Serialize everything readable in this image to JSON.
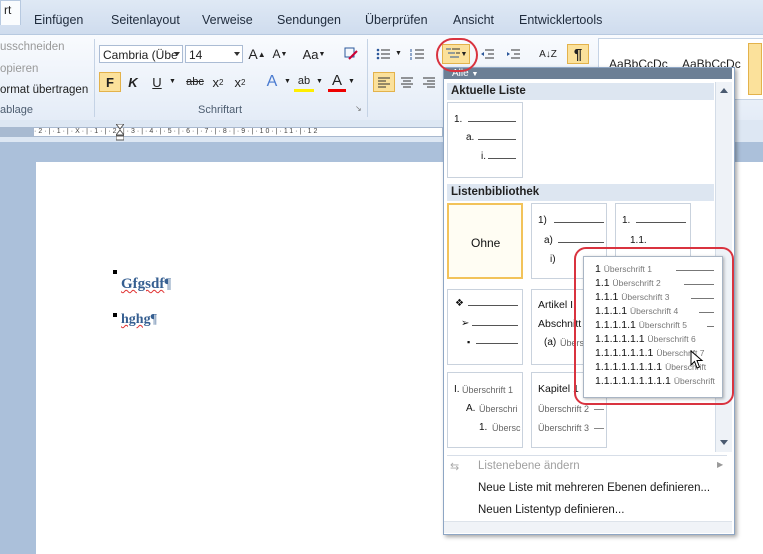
{
  "tabs": {
    "active": "rt",
    "items": [
      "Einfügen",
      "Seitenlayout",
      "Verweise",
      "Sendungen",
      "Überprüfen",
      "Ansicht",
      "Entwicklertools"
    ]
  },
  "clipboard": {
    "cut": "usschneiden",
    "copy": "opieren",
    "format_painter": "ormat übertragen",
    "group_label": "ablage"
  },
  "font": {
    "name": "Cambria (Übe",
    "size": "14",
    "grow": "A",
    "shrink": "A",
    "case": "Aa",
    "bold": "F",
    "italic": "K",
    "underline": "U",
    "strike": "abc",
    "sub": "x",
    "super": "x",
    "effects": "A",
    "highlight": "ab",
    "color": "A",
    "group_label": "Schriftart"
  },
  "paragraph": {
    "sort": "A↓Z",
    "pilcrow": "¶"
  },
  "styles": {
    "sample1": "AaBbCcDc",
    "sample2": "AaBbCcDc"
  },
  "ruler": {
    "text": "·2·|·1·|·X·|·1·|·2·|·3·|·4·|·5·|·6·|·7·|·8·|·9·|·10·|·11·|·12"
  },
  "document": {
    "para1": "Gfgsdf",
    "para2": "hghg",
    "pilcrow": "¶"
  },
  "dropdown": {
    "filter": "Alle",
    "section_current": "Aktuelle Liste",
    "current_list": [
      "1.",
      "a.",
      "i."
    ],
    "section_library": "Listenbibliothek",
    "none_label": "Ohne",
    "tile_numbered": [
      "1)",
      "a)",
      "i)"
    ],
    "tile_decimal": [
      "1.",
      "1.1."
    ],
    "tile_article": [
      "Artikel I.",
      "Abschnitt",
      "(a)",
      "Übers"
    ],
    "tile_roman": [
      "I.",
      "A.",
      "1.",
      "Überschrift 1",
      "Überschri",
      "Übersc"
    ],
    "tile_chapter": [
      "Kapitel 1",
      "Überschrift 2",
      "Überschrift 3"
    ],
    "menu_change_level": "Listenebene ändern",
    "menu_define_list": "Neue Liste mit mehreren Ebenen definieren...",
    "menu_define_style": "Neuen Listentyp definieren..."
  },
  "preview": {
    "rows": [
      {
        "num": "1",
        "label": "Überschrift 1"
      },
      {
        "num": "1.1",
        "label": "Überschrift 2"
      },
      {
        "num": "1.1.1",
        "label": "Überschrift 3"
      },
      {
        "num": "1.1.1.1",
        "label": "Überschrift 4"
      },
      {
        "num": "1.1.1.1.1",
        "label": "Überschrift 5"
      },
      {
        "num": "1.1.1.1.1.1",
        "label": "Überschrift 6"
      },
      {
        "num": "1.1.1.1.1.1.1",
        "label": "Überschrift 7"
      },
      {
        "num": "1.1.1.1.1.1.1.1",
        "label": "Überschrift"
      },
      {
        "num": "1.1.1.1.1.1.1.1.1",
        "label": "Überschrift"
      }
    ]
  },
  "colors": {
    "annotation_red": "#d9333f",
    "heading_blue": "#365f91",
    "ribbon_highlight": "#fbe19b"
  }
}
